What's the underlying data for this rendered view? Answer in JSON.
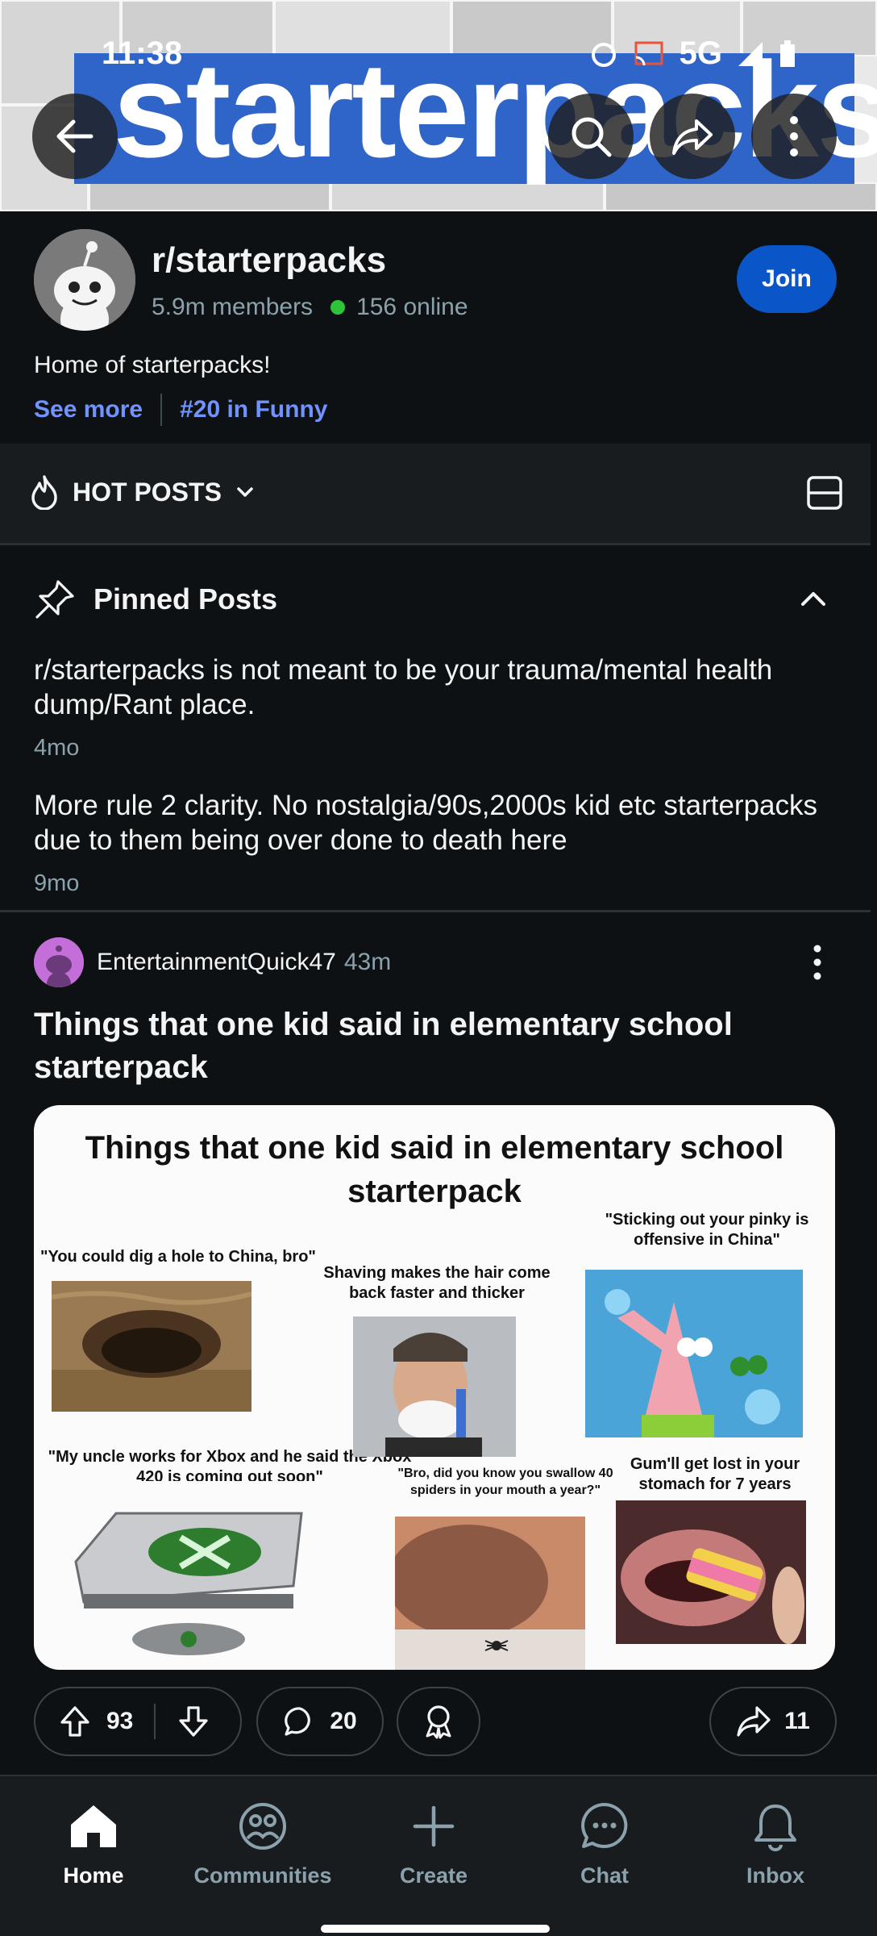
{
  "status_bar": {
    "time": "11:38",
    "network": "5G"
  },
  "banner": {
    "word": "starterpacks",
    "back_icon": "arrow-left-icon",
    "search_icon": "search-icon",
    "share_icon": "share-icon",
    "more_icon": "more-vertical-icon"
  },
  "community": {
    "name": "r/starterpacks",
    "members": "5.9m members",
    "online": "156 online",
    "join_label": "Join",
    "description": "Home of starterpacks!",
    "see_more": "See more",
    "rank": "#20 in Funny"
  },
  "sort": {
    "label": "HOT POSTS"
  },
  "pinned": {
    "heading": "Pinned Posts",
    "items": [
      {
        "title": "r/starterpacks is not meant to be your trauma/mental health dump/Rant place.",
        "age": "4mo"
      },
      {
        "title": "More rule 2 clarity. No nostalgia/90s,2000s kid etc starterpacks due to them being over done to death here",
        "age": "9mo"
      }
    ]
  },
  "post": {
    "author": "EntertainmentQuick47",
    "age": "43m",
    "title": "Things that one kid said in elementary school starterpack",
    "image": {
      "title": "Things that one kid said in elementary school starterpack",
      "captions": [
        "\"You could dig a hole to China, bro\"",
        "Shaving makes the hair come back faster and thicker",
        "\"Sticking out your pinky is offensive in China\"",
        "\"My uncle works for Xbox and he said the Xbox 420 is coming out soon\"",
        "\"Bro, did you know you swallow 40 spiders in your mouth a year?\"",
        "Gum'll get lost in your stomach for 7 years"
      ]
    },
    "upvotes": "93",
    "comments": "20",
    "shares": "11"
  },
  "nav": {
    "items": [
      {
        "label": "Home",
        "icon": "home-icon"
      },
      {
        "label": "Communities",
        "icon": "communities-icon"
      },
      {
        "label": "Create",
        "icon": "plus-icon"
      },
      {
        "label": "Chat",
        "icon": "chat-icon"
      },
      {
        "label": "Inbox",
        "icon": "bell-icon"
      }
    ]
  },
  "colors": {
    "background": "#0e1113",
    "accent_blue": "#0a55c7",
    "link_blue": "#7193ff",
    "online_green": "#2ec43a",
    "muted_text": "#8ba2ad"
  }
}
